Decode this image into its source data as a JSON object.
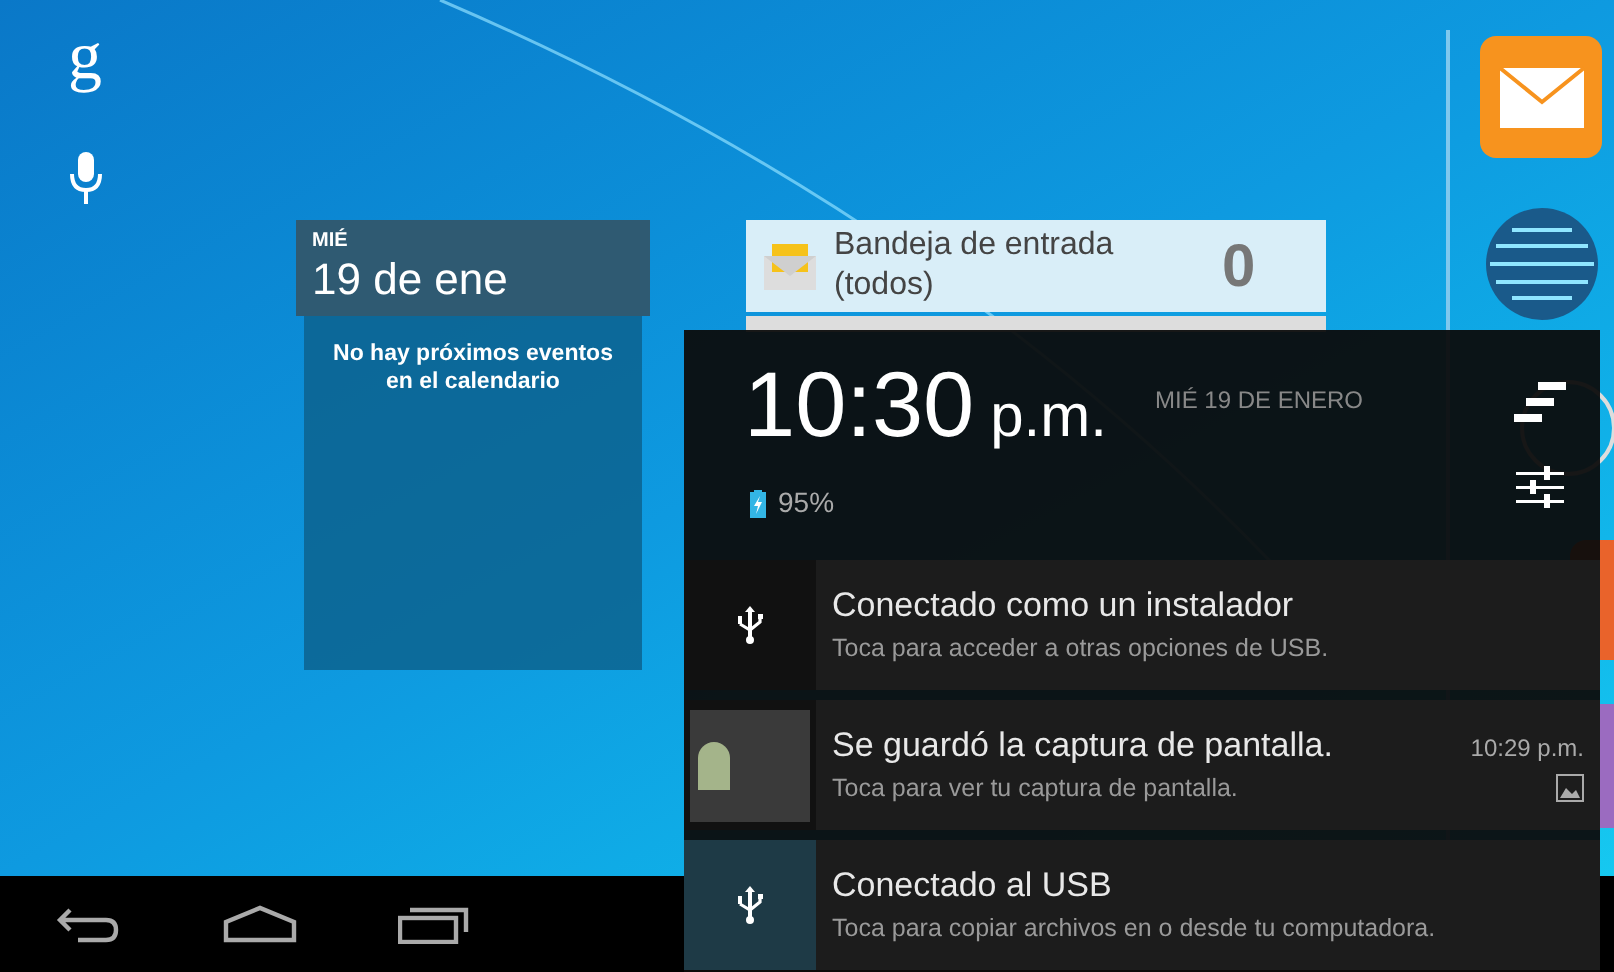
{
  "search": {
    "logo": "g"
  },
  "calendar_widget": {
    "day": "MIÉ",
    "date": "19 de ene",
    "message": "No hay próximos eventos en el calendario"
  },
  "email_widget": {
    "label": "Bandeja de entrada (todos)",
    "count": "0"
  },
  "notification_panel": {
    "time": "10:30",
    "period": "p.m.",
    "date": "MIÉ 19 DE ENERO",
    "battery": "95%",
    "notifications": [
      {
        "kind": "usb",
        "title": "Conectado como un instalador",
        "text": "Toca para acceder a otras opciones de USB.",
        "highlighted": false
      },
      {
        "kind": "screenshot",
        "title": "Se guardó la captura de pantalla.",
        "text": "Toca para ver tu captura de pantalla.",
        "time": "10:29 p.m.",
        "highlighted": false
      },
      {
        "kind": "usb",
        "title": "Conectado al USB",
        "text": "Toca para copiar archivos en o desde tu computadora.",
        "highlighted": true
      }
    ]
  }
}
